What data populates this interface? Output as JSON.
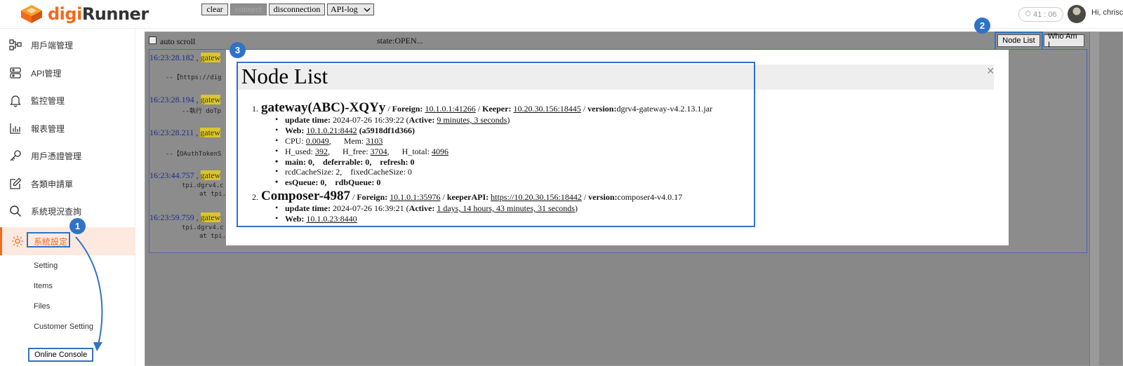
{
  "header": {
    "brand_a": "digi",
    "brand_b": "Runner",
    "timer": "41 : 06",
    "greeting": "Hi, chrisc"
  },
  "sidebar": {
    "items": [
      {
        "label": "用戶端管理",
        "icon": "client-icon"
      },
      {
        "label": "API管理",
        "icon": "api-icon"
      },
      {
        "label": "監控管理",
        "icon": "bell-icon"
      },
      {
        "label": "報表管理",
        "icon": "chart-icon"
      },
      {
        "label": "用戶憑證管理",
        "icon": "key-icon"
      },
      {
        "label": "各類申請單",
        "icon": "edit-icon"
      },
      {
        "label": "系統現況查詢",
        "icon": "search-icon"
      },
      {
        "label": "系統設定",
        "icon": "gear-icon",
        "active": true
      }
    ],
    "subitems": [
      "Setting",
      "Items",
      "Files",
      "Customer Setting",
      "Online Console"
    ]
  },
  "toolbar": {
    "auto_scroll": "auto scroll",
    "clear": "clear",
    "connect": "connect",
    "disconnection": "disconnection",
    "select_value": "API-log",
    "state": "state:OPEN...",
    "node_list": "Node List",
    "who_am_i": "Who Am I"
  },
  "log": {
    "entries": [
      {
        "time": "16:23:28.182 , ",
        "tag": "gatew",
        "line": "--【https://dig"
      },
      {
        "time": "16:23:28.194 , ",
        "tag": "gatew",
        "line": "--執行 doTp"
      },
      {
        "time": "16:23:28.211 , ",
        "tag": "gatew",
        "line": "--【OAuthTokenS"
      },
      {
        "time": "16:23:44.757 , ",
        "tag": "gatew",
        "line": "tpi.dgrv4.c",
        "line2": "at tpi."
      },
      {
        "time": "16:23:59.759 , ",
        "tag": "gatew",
        "line": "tpi.dgrv4.c",
        "line2": "at tpi."
      }
    ]
  },
  "modal": {
    "title": "Node List",
    "close": "×",
    "nodes": [
      {
        "num": "1.",
        "name": "gateway(ABC)-XQYy",
        "sep": " / ",
        "foreign_label": "Foreign:",
        "foreign": "10.1.0.1:41266",
        "second_label": "Keeper:",
        "second": "10.20.30.156:18445",
        "version_label": "version:",
        "version": "dgrv4-gateway-v4.2.13.1.jar",
        "update_label": "update time:",
        "update_time": "2024-07-26 16:39:22",
        "active_label": "Active:",
        "active": "9 minutes, 3 seconds",
        "web_label": "Web:",
        "web": "10.1.0.21:8442",
        "web_extra": "(a5918df1d366)",
        "cpu_label": "CPU:",
        "cpu": "0.0049",
        "mem_label": "Mem:",
        "mem": "3103",
        "hused_label": "H_used:",
        "hused": "392",
        "hfree_label": "H_free:",
        "hfree": "3704",
        "htotal_label": "H_total:",
        "htotal": "4096",
        "main_line": "main: 0,    deferrable: 0,    refresh: 0",
        "rcd_line": "rcdCacheSize: 2,    fixedCacheSize: 0",
        "queue_line": "esQueue: 0,    rdbQueue: 0"
      },
      {
        "num": "2.",
        "name": "Composer-4987",
        "foreign_label": "Foreign:",
        "foreign": "10.1.0.1:35976",
        "second_label": "keeperAPI:",
        "second": "https://10.20.30.156:18442",
        "version_label": "version:",
        "version": "composer4-v4.0.17",
        "update_label": "update time:",
        "update_time": "2024-07-26 16:39:21",
        "active_label": "Active:",
        "active": "1 days, 14 hours, 43 minutes, 31 seconds",
        "web_label": "Web:",
        "web": "10.1.0.23:8440"
      }
    ]
  },
  "badges": [
    "1",
    "2",
    "3"
  ],
  "colors": {
    "brand": "#f26b1d",
    "annotation": "#2f73c6",
    "gateway_tag": "#d8c52f"
  }
}
